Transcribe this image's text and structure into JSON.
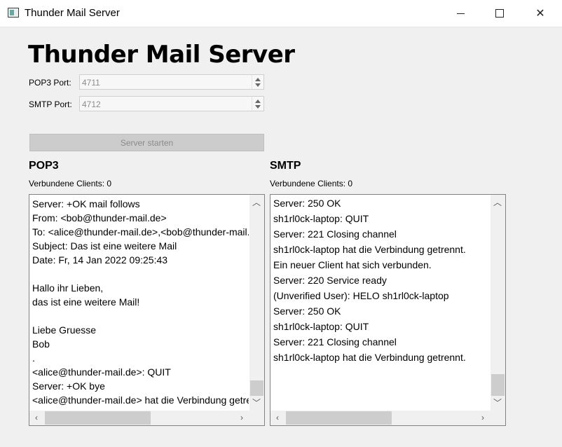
{
  "window": {
    "title": "Thunder Mail Server"
  },
  "heading": "Thunder Mail Server",
  "config": {
    "pop3_label": "POP3 Port:",
    "pop3_value": "4711",
    "smtp_label": "SMTP Port:",
    "smtp_value": "4712",
    "start_button": "Server starten"
  },
  "pop3": {
    "title": "POP3",
    "clients": "Verbundene Clients: 0",
    "log": "Server: +OK mail follows\nFrom: <bob@thunder-mail.de>\nTo: <alice@thunder-mail.de>,<bob@thunder-mail.de>\nSubject: Das ist eine weitere Mail\nDate: Fr, 14 Jan 2022 09:25:43\n\nHallo ihr Lieben,\ndas ist eine weitere Mail!\n\nLiebe Gruesse\nBob\n.\n<alice@thunder-mail.de>: QUIT\nServer: +OK bye\n<alice@thunder-mail.de> hat die Verbindung getrennt."
  },
  "smtp": {
    "title": "SMTP",
    "clients": "Verbundene Clients: 0",
    "log": "Server: 250 OK\nsh1rl0ck-laptop: QUIT\nServer: 221 Closing channel\nsh1rl0ck-laptop hat die Verbindung getrennt.\nEin neuer Client hat sich verbunden.\nServer: 220 Service ready\n(Unverified User): HELO sh1rl0ck-laptop\nServer: 250 OK\nsh1rl0ck-laptop: QUIT\nServer: 221 Closing channel\nsh1rl0ck-laptop hat die Verbindung getrennt."
  },
  "icons": {
    "app": "app-window-icon",
    "minimize": "minimize-icon",
    "maximize": "maximize-icon",
    "close": "close-icon",
    "up": "spin-up-icon",
    "down": "spin-down-icon"
  }
}
